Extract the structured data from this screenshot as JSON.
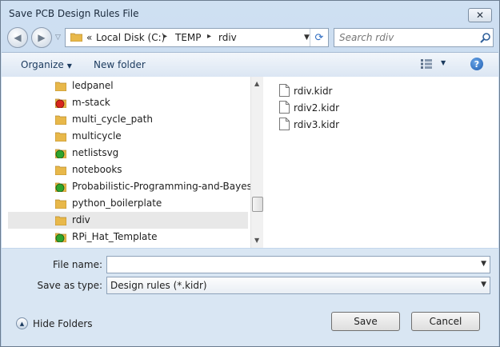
{
  "window": {
    "title": "Save PCB Design Rules File",
    "close_glyph": "✕"
  },
  "nav": {
    "back_glyph": "◀",
    "forward_glyph": "▶",
    "dropdown_glyph": "▽",
    "path_prefix": "«",
    "breadcrumb": [
      "Local Disk (C:)",
      "TEMP",
      "rdiv"
    ],
    "path_sep": "▸",
    "dropdown_arrow": "▼",
    "refresh_glyph": "⟳",
    "search_placeholder": "Search rdiv"
  },
  "toolbar": {
    "organize_label": "Organize",
    "organize_arrow": "▼",
    "new_folder_label": "New folder",
    "views_arrow": "▼",
    "help_glyph": "?"
  },
  "tree": {
    "items": [
      {
        "label": "ledpanel",
        "icon": "folder-icon",
        "color": "#e8b84a"
      },
      {
        "label": "m-stack",
        "icon": "status-red-icon",
        "color": "#d9261c"
      },
      {
        "label": "multi_cycle_path",
        "icon": "folder-icon",
        "color": "#e8b84a"
      },
      {
        "label": "multicycle",
        "icon": "folder-icon",
        "color": "#e8b84a"
      },
      {
        "label": "netlistsvg",
        "icon": "status-green-icon",
        "color": "#2fa52c"
      },
      {
        "label": "notebooks",
        "icon": "folder-icon",
        "color": "#e8b84a"
      },
      {
        "label": "Probabilistic-Programming-and-Bayesian",
        "icon": "status-green-icon",
        "color": "#2fa52c"
      },
      {
        "label": "python_boilerplate",
        "icon": "folder-icon",
        "color": "#e8b84a"
      },
      {
        "label": "rdiv",
        "icon": "folder-icon",
        "color": "#e8b84a",
        "selected": true
      },
      {
        "label": "RPi_Hat_Template",
        "icon": "status-green-icon",
        "color": "#2fa52c"
      }
    ],
    "scroll_up_glyph": "▲",
    "scroll_down_glyph": "▼"
  },
  "files": {
    "items": [
      {
        "label": "rdiv.kidr",
        "icon": "document-icon"
      },
      {
        "label": "rdiv2.kidr",
        "icon": "document-icon"
      },
      {
        "label": "rdiv3.kidr",
        "icon": "document-icon"
      }
    ]
  },
  "form": {
    "file_name_label": "File name:",
    "file_name_value": "",
    "save_as_type_label": "Save as type:",
    "save_as_type_value": "Design rules (*.kidr)",
    "dropdown_arrow": "▼"
  },
  "footer": {
    "hide_folders_label": "Hide Folders",
    "hide_folders_glyph": "▲",
    "save_label": "Save",
    "cancel_label": "Cancel"
  },
  "colors": {
    "accent": "#1b3a5e",
    "folder": "#e8b84a",
    "status_green": "#2fa52c",
    "status_red": "#d9261c"
  }
}
